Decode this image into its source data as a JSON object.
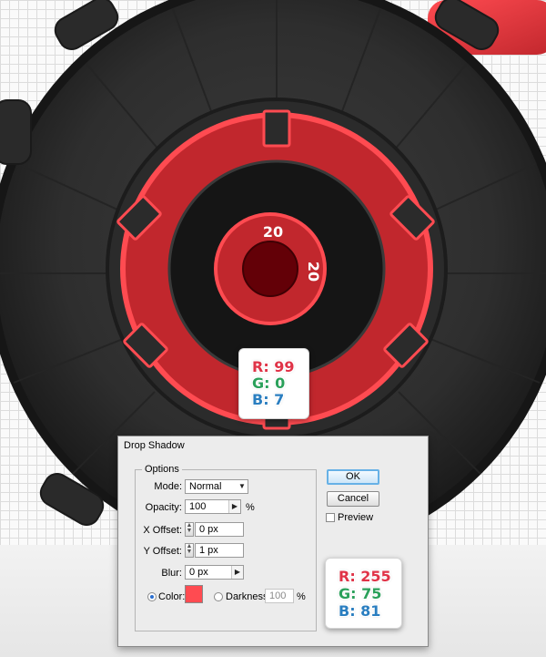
{
  "illustration": {
    "ring_colors": {
      "tire": "#2e2e2e",
      "red_ring": "#c1272d",
      "inner_ring_glow": "#ff4b51",
      "hub_center": "#630007",
      "inner_black": "#151515"
    },
    "dimension_labels": [
      "20",
      "20"
    ]
  },
  "rgb_callout_small": {
    "r_label": "R: 99",
    "g_label": "G: 0",
    "b_label": "B: 7"
  },
  "rgb_callout_large": {
    "r_label": "R: 255",
    "g_label": "G: 75",
    "b_label": "B: 81"
  },
  "dialog": {
    "title": "Drop Shadow",
    "group_label": "Options",
    "mode": {
      "label": "Mode:",
      "value": "Normal"
    },
    "opacity": {
      "label": "Opacity:",
      "value": "100",
      "unit": "%"
    },
    "x_offset": {
      "label": "X Offset:",
      "value": "0 px"
    },
    "y_offset": {
      "label": "Y Offset:",
      "value": "1 px"
    },
    "blur": {
      "label": "Blur:",
      "value": "0 px"
    },
    "color": {
      "label": "Color:",
      "swatch": "#ff4b51",
      "selected": true
    },
    "darkness": {
      "label": "Darkness:",
      "value": "100",
      "unit": "%"
    },
    "ok_label": "OK",
    "cancel_label": "Cancel",
    "preview_label": "Preview"
  }
}
